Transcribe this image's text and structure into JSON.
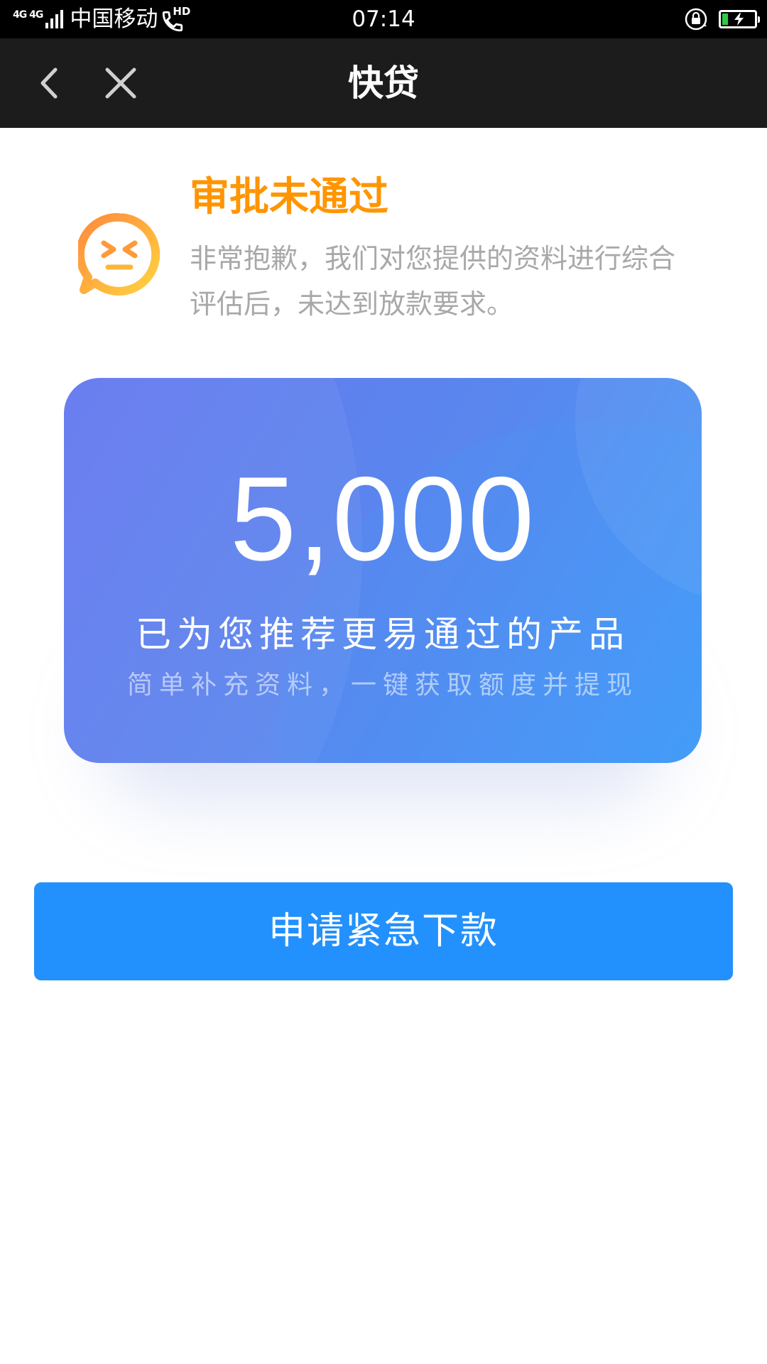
{
  "status_bar": {
    "network": "4G 4G",
    "carrier": "中国移动",
    "hd_label": "HD",
    "time": "07:14",
    "battery_color": "#2ecc40",
    "icons": [
      "signal-icon",
      "call-icon",
      "rotation-lock-icon",
      "battery-charging-icon"
    ]
  },
  "header": {
    "title": "快贷",
    "back_icon": "chevron-left-icon",
    "close_icon": "close-icon"
  },
  "result": {
    "icon": "sad-face-icon",
    "title": "审批未通过",
    "description": "非常抱歉，我们对您提供的资料进行综合评估后，未达到放款要求。",
    "title_color": "#ff9500"
  },
  "card": {
    "amount": "5,000",
    "line1": "已为您推荐更易通过的产品",
    "line2": "简单补充资料，一键获取额度并提现"
  },
  "action": {
    "button_label": "申请紧急下款",
    "button_color": "#2391fd"
  }
}
